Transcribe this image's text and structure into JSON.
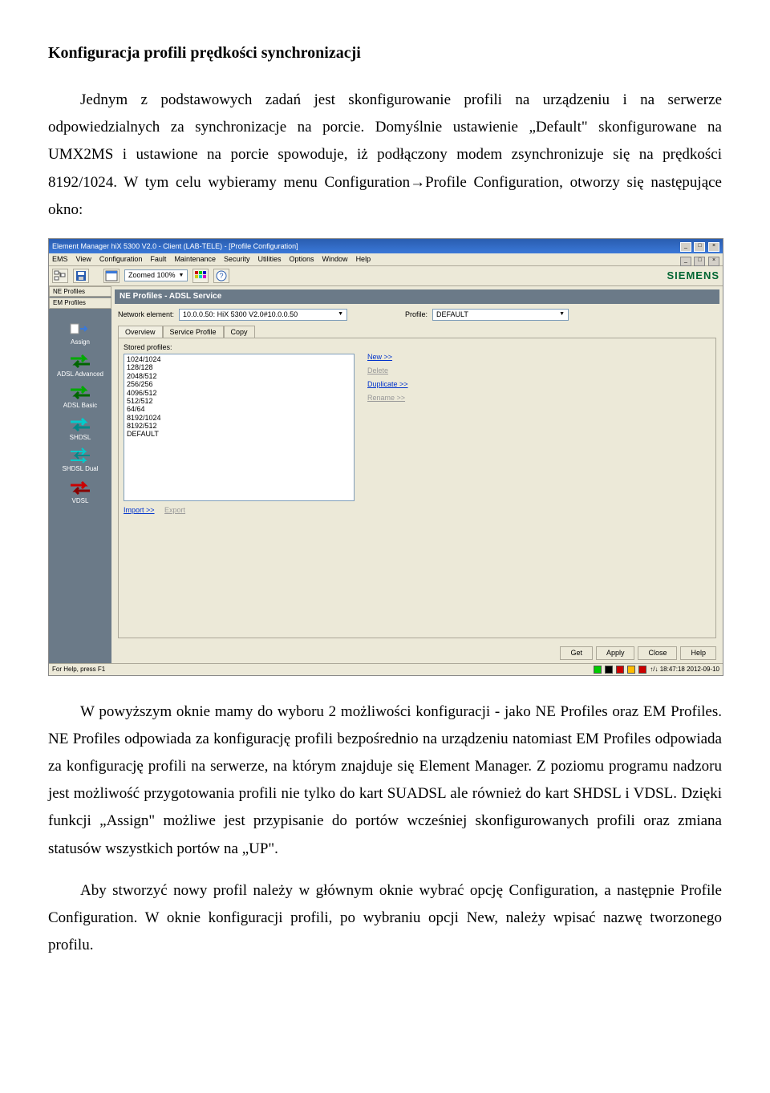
{
  "doc": {
    "title": "Konfiguracja profili prędkości synchronizacji",
    "p1": "Jednym z podstawowych zadań jest skonfigurowanie profili na urządzeniu i na serwerze odpowiedzialnych za synchronizacje na porcie. Domyślnie ustawienie „Default\" skonfigurowane na UMX2MS i ustawione na porcie spowoduje, iż podłączony modem zsynchronizuje się na prędkości 8192/1024. W tym celu wybieramy menu Configuration→Profile Configuration, otworzy się następujące okno:",
    "p2": "W powyższym oknie mamy do wyboru 2 możliwości konfiguracji - jako NE Profiles oraz EM Profiles. NE Profiles odpowiada za konfigurację profili bezpośrednio na urządzeniu natomiast EM Profiles odpowiada za konfigurację profili na serwerze, na którym znajduje się Element Manager. Z poziomu programu nadzoru jest możliwość przygotowania profili nie tylko do kart SUADSL ale również do kart SHDSL i VDSL. Dzięki funkcji „Assign\" możliwe jest przypisanie do portów wcześniej skonfigurowanych profili oraz zmiana statusów wszystkich portów na „UP\".",
    "p3": "Aby stworzyć nowy profil należy w głównym oknie wybrać opcję Configuration, a następnie Profile Configuration. W oknie konfiguracji profili, po wybraniu opcji New, należy wpisać nazwę tworzonego profilu."
  },
  "app": {
    "title": "Element Manager hiX 5300 V2.0 - Client (LAB-TELE) - [Profile Configuration]",
    "menus": [
      "EMS",
      "View",
      "Configuration",
      "Fault",
      "Maintenance",
      "Security",
      "Utilities",
      "Options",
      "Window",
      "Help"
    ],
    "zoom_label": "Zoomed 100%",
    "brand": "SIEMENS",
    "side_tabs": [
      "NE Profiles",
      "EM Profiles"
    ],
    "side_items": [
      {
        "label": "Assign"
      },
      {
        "label": "ADSL Advanced"
      },
      {
        "label": "ADSL Basic"
      },
      {
        "label": "SHDSL"
      },
      {
        "label": "SHDSL Dual"
      },
      {
        "label": "VDSL"
      }
    ],
    "panel_title": "NE Profiles - ADSL Service",
    "field_ne_label": "Network element:",
    "field_ne_value": "10.0.0.50: HiX 5300 V2.0#10.0.0.50",
    "field_profile_label": "Profile:",
    "field_profile_value": "DEFAULT",
    "inner_tabs": [
      "Overview",
      "Service Profile",
      "Copy"
    ],
    "stored_label": "Stored profiles:",
    "stored_profiles": [
      "1024/1024",
      "128/128",
      "2048/512",
      "256/256",
      "4096/512",
      "512/512",
      "64/64",
      "8192/1024",
      "8192/512",
      "DEFAULT"
    ],
    "actions": {
      "new": "New >>",
      "delete": "Delete",
      "duplicate": "Duplicate >>",
      "rename": "Rename >>"
    },
    "io": {
      "import": "Import >>",
      "export": "Export"
    },
    "footer_buttons": [
      "Get",
      "Apply",
      "Close",
      "Help"
    ],
    "status_left": "For Help, press F1",
    "status_right": "↑/↓  18:47:18  2012-09-10"
  }
}
